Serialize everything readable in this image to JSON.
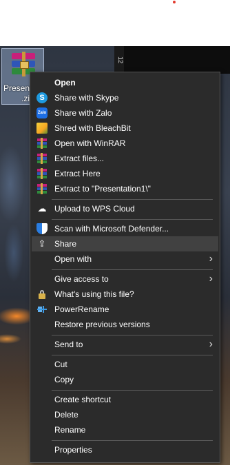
{
  "desktop": {
    "file_label_line1": "Present",
    "file_label_line2": ".zi",
    "side_strip_text": "12"
  },
  "menu": {
    "items": [
      {
        "label": "Open",
        "icon": "none",
        "bold": true,
        "submenu": false
      },
      {
        "label": "Share with Skype",
        "icon": "skype-icon",
        "icon_glyph": "S"
      },
      {
        "label": "Share with Zalo",
        "icon": "zalo-icon",
        "icon_glyph": "Zalo"
      },
      {
        "label": "Shred with BleachBit",
        "icon": "bleachbit-icon"
      },
      {
        "label": "Open with WinRAR",
        "icon": "winrar-icon"
      },
      {
        "label": "Extract files...",
        "icon": "winrar-icon"
      },
      {
        "label": "Extract Here",
        "icon": "winrar-icon"
      },
      {
        "label": "Extract to \"Presentation1\\\"",
        "icon": "winrar-icon"
      },
      {
        "label": "Upload to WPS Cloud",
        "icon": "cloud-icon",
        "icon_glyph": "☁"
      },
      {
        "label": "Scan with Microsoft Defender...",
        "icon": "defender-shield-icon"
      },
      {
        "label": "Share",
        "icon": "share-icon",
        "icon_glyph": "⇪",
        "highlighted": true
      },
      {
        "label": "Open with",
        "submenu": true
      },
      {
        "label": "Give access to",
        "submenu": true
      },
      {
        "label": "What's using this file?",
        "icon": "lock-icon"
      },
      {
        "label": "PowerRename",
        "icon": "powerrename-icon"
      },
      {
        "label": "Restore previous versions"
      },
      {
        "label": "Send to",
        "submenu": true
      },
      {
        "label": "Cut"
      },
      {
        "label": "Copy"
      },
      {
        "label": "Create shortcut"
      },
      {
        "label": "Delete"
      },
      {
        "label": "Rename"
      },
      {
        "label": "Properties"
      }
    ],
    "submenu_arrow": "›"
  },
  "colors": {
    "menu_bg": "#2b2b2b",
    "menu_hover": "#414141",
    "separator": "#5a5a5a",
    "text": "#ffffff"
  }
}
